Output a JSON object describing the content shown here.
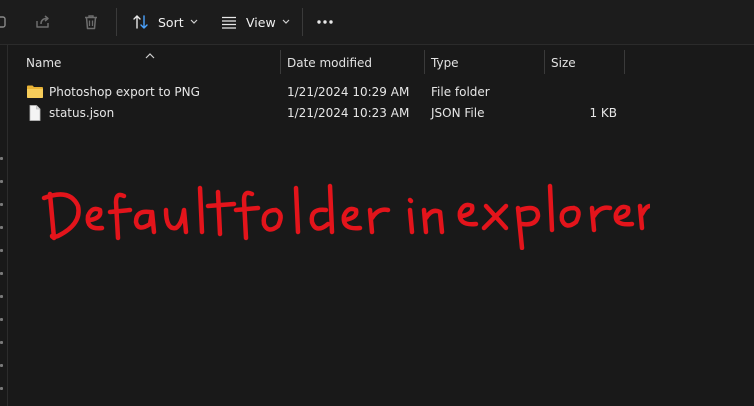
{
  "toolbar": {
    "sort_label": "Sort",
    "view_label": "View"
  },
  "columns": {
    "name": "Name",
    "date_modified": "Date modified",
    "type": "Type",
    "size": "Size"
  },
  "files": [
    {
      "name": "Photoshop export to PNG",
      "date_modified": "1/21/2024 10:29 AM",
      "type": "File folder",
      "size": "",
      "icon": "folder-icon"
    },
    {
      "name": "status.json",
      "date_modified": "1/21/2024 10:23 AM",
      "type": "JSON File",
      "size": "1 KB",
      "icon": "file-icon"
    }
  ],
  "annotation": {
    "text": "Default folder in explorer.",
    "color": "#e3141b"
  },
  "colors": {
    "background": "#191919",
    "toolbar": "#1c1c1c",
    "folder": "#f0c24a",
    "text": "#e6e6e6",
    "annotation": "#e3141b"
  }
}
